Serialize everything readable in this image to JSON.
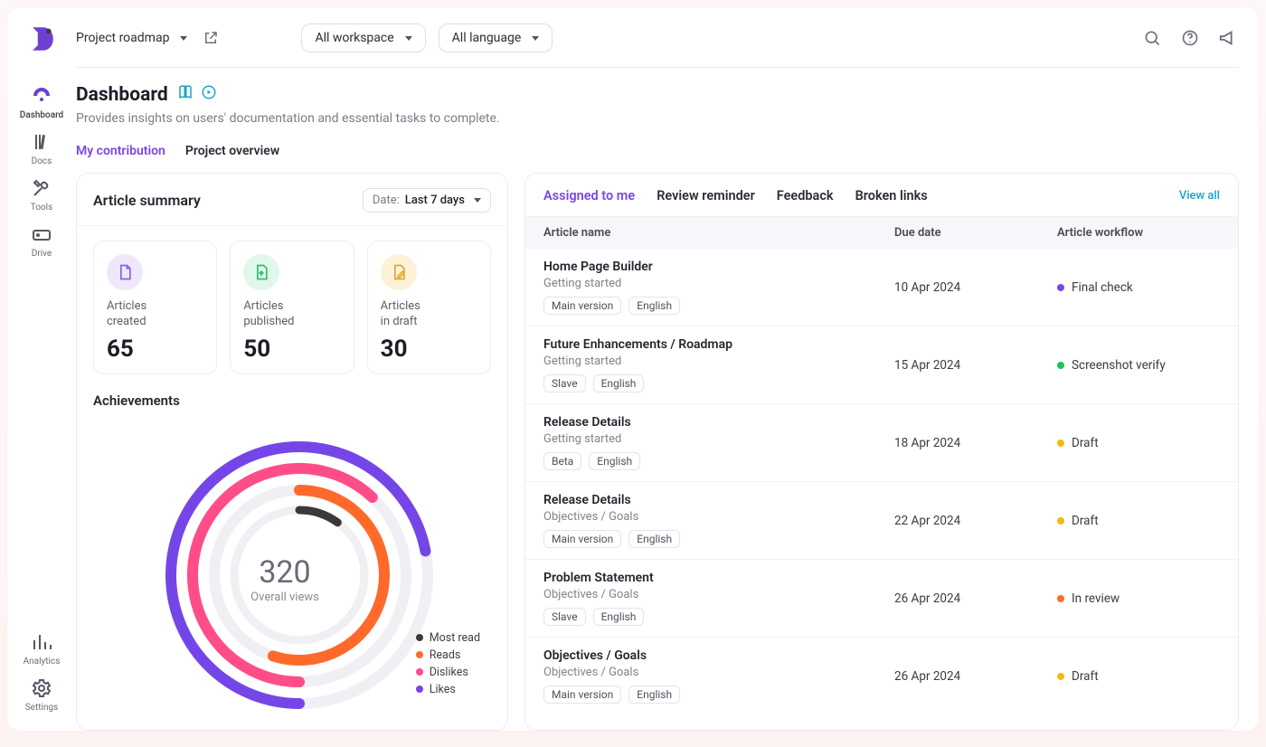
{
  "sidebar": {
    "items": [
      {
        "id": "dashboard",
        "label": "Dashboard",
        "active": true
      },
      {
        "id": "docs",
        "label": "Docs",
        "active": false
      },
      {
        "id": "tools",
        "label": "Tools",
        "active": false
      },
      {
        "id": "drive",
        "label": "Drive",
        "active": false
      }
    ],
    "bottom": [
      {
        "id": "analytics",
        "label": "Analytics"
      },
      {
        "id": "settings",
        "label": "Settings"
      }
    ]
  },
  "topbar": {
    "project_label": "Project roadmap",
    "workspace_filter": "All workspace",
    "language_filter": "All language"
  },
  "page": {
    "title": "Dashboard",
    "subtitle": "Provides insights on users' documentation and essential tasks to complete.",
    "tabs": [
      {
        "id": "my_contribution",
        "label": "My contribution",
        "active": true
      },
      {
        "id": "project_overview",
        "label": "Project overview",
        "active": false
      }
    ]
  },
  "summary": {
    "title": "Article summary",
    "date_prefix": "Date:",
    "date_range": "Last 7 days",
    "stats": [
      {
        "label": "Articles\ncreated",
        "value": "65",
        "tint": "purple",
        "icon": "doc-icon"
      },
      {
        "label": "Articles\npublished",
        "value": "50",
        "tint": "green",
        "icon": "doc-up-icon"
      },
      {
        "label": "Articles\nin draft",
        "value": "30",
        "tint": "yellow",
        "icon": "doc-edit-icon"
      }
    ],
    "achievements_title": "Achievements",
    "center_value": "320",
    "center_label": "Overall views",
    "legend": [
      {
        "label": "Most read",
        "color": "#3a3a3a"
      },
      {
        "label": "Reads",
        "color": "#ff6a2b"
      },
      {
        "label": "Dislikes",
        "color": "#ff4d8a"
      },
      {
        "label": "Likes",
        "color": "#7546e7"
      }
    ]
  },
  "chart_data": {
    "type": "donut_progress_rings",
    "center_value": 320,
    "center_label": "Overall views",
    "series": [
      {
        "name": "Most read",
        "color": "#3a3a3a",
        "fraction": 0.1
      },
      {
        "name": "Reads",
        "color": "#ff6a2b",
        "fraction": 0.55
      },
      {
        "name": "Dislikes",
        "color": "#ff4d8a",
        "fraction": 0.62
      },
      {
        "name": "Likes",
        "color": "#7546e7",
        "fraction": 0.72
      }
    ],
    "note": "Rings drawn clockwise from 12 o'clock. Dislikes & Likes use an extra 180° offset (start at 6 o'clock). Fractions interpolated from arc sweep — roughly Most read≈10%, Reads≈55%, Dislikes≈62%, Likes≈72% of a full circle."
  },
  "tasks": {
    "tabs": [
      {
        "id": "assigned",
        "label": "Assigned to me",
        "active": true
      },
      {
        "id": "review",
        "label": "Review reminder",
        "active": false
      },
      {
        "id": "feedback",
        "label": "Feedback",
        "active": false
      },
      {
        "id": "broken",
        "label": "Broken links",
        "active": false
      }
    ],
    "view_all_label": "View all",
    "columns": [
      "Article name",
      "Due date",
      "Article workflow"
    ],
    "rows": [
      {
        "name": "Home Page Builder",
        "category": "Getting started",
        "tags": [
          "Main version",
          "English"
        ],
        "due": "10 Apr 2024",
        "workflow": "Final check",
        "dot": "#7b45e6"
      },
      {
        "name": "Future Enhancements / Roadmap",
        "category": "Getting started",
        "tags": [
          "Slave",
          "English"
        ],
        "due": "15 Apr 2024",
        "workflow": "Screenshot verify",
        "dot": "#22c05a"
      },
      {
        "name": "Release Details",
        "category": "Getting started",
        "tags": [
          "Beta",
          "English"
        ],
        "due": "18 Apr 2024",
        "workflow": "Draft",
        "dot": "#f2b913"
      },
      {
        "name": "Release Details",
        "category": "Objectives / Goals",
        "tags": [
          "Main version",
          "English"
        ],
        "due": "22 Apr 2024",
        "workflow": "Draft",
        "dot": "#f2b913"
      },
      {
        "name": "Problem Statement",
        "category": "Objectives / Goals",
        "tags": [
          "Slave",
          "English"
        ],
        "due": "26 Apr 2024",
        "workflow": "In review",
        "dot": "#ff6a2b"
      },
      {
        "name": "Objectives / Goals",
        "category": "Objectives / Goals",
        "tags": [
          "Main version",
          "English"
        ],
        "due": "26 Apr 2024",
        "workflow": "Draft",
        "dot": "#f2b913"
      }
    ]
  },
  "colors": {
    "accent": "#7b45e6",
    "link": "#1aa4c9"
  }
}
